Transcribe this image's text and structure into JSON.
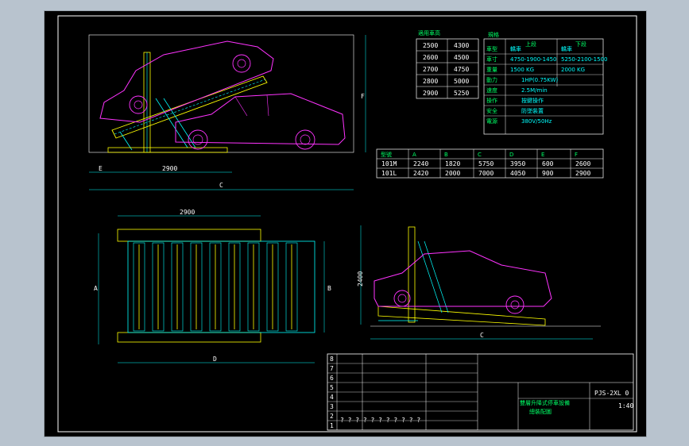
{
  "colors": {
    "frame": "#ffffff",
    "car": "#ff33ff",
    "structure": "#00ffff",
    "rails": "#ffff00",
    "table_text": "#ffffff",
    "header_text": "#00ff66"
  },
  "side_view": {
    "dim_e": "E",
    "dim_2900": "2900",
    "dim_c": "C",
    "dim_f": "F"
  },
  "height_table": {
    "header": "適用車高",
    "rows": [
      [
        "2500",
        "4300"
      ],
      [
        "2600",
        "4500"
      ],
      [
        "2700",
        "4750"
      ],
      [
        "2800",
        "5000"
      ],
      [
        "2900",
        "5250"
      ]
    ]
  },
  "spec_table": {
    "col_headers": [
      "規格",
      "上段",
      "下段"
    ],
    "rows": [
      {
        "label": "車型",
        "a": "轎車",
        "b": "轎車"
      },
      {
        "label": "車寸",
        "a": "4750-1900-1450",
        "b": "5250-2100-1500"
      },
      {
        "label": "重量",
        "a": "1500 KG",
        "b": "2000 KG"
      },
      {
        "label": "動力",
        "a": "1HP(0.75KW)",
        "b": ""
      },
      {
        "label": "速度",
        "a": "2.5M/min",
        "b": ""
      },
      {
        "label": "操作",
        "a": "按鍵操作",
        "b": ""
      },
      {
        "label": "安全",
        "a": "防墜裝置",
        "b": ""
      },
      {
        "label": "電源",
        "a": "380V/50Hz",
        "b": ""
      }
    ]
  },
  "model_table": {
    "headers": [
      "型號",
      "A",
      "B",
      "C",
      "D",
      "E",
      "F"
    ],
    "rows": [
      [
        "101M",
        "2240",
        "1820",
        "5750",
        "3950",
        "600",
        "2600"
      ],
      [
        "101L",
        "2420",
        "2000",
        "7000",
        "4050",
        "900",
        "2900"
      ]
    ]
  },
  "plan_view": {
    "dim_2900": "2900",
    "dim_a": "A",
    "dim_b": "B",
    "dim_d": "D"
  },
  "front_view": {
    "dim_2400": "2400",
    "dim_c": "C"
  },
  "title_block": {
    "row_numbers": [
      "8",
      "7",
      "6",
      "5",
      "4",
      "3",
      "2",
      "1"
    ],
    "drawing_no": "PJS-2XL 0",
    "title_line1": "雙層升降式停車設備",
    "title_line2": "總裝配圖",
    "scale": "1:40",
    "question_marks": "? ? ? ? ? ? ? ? ? ? ?"
  }
}
